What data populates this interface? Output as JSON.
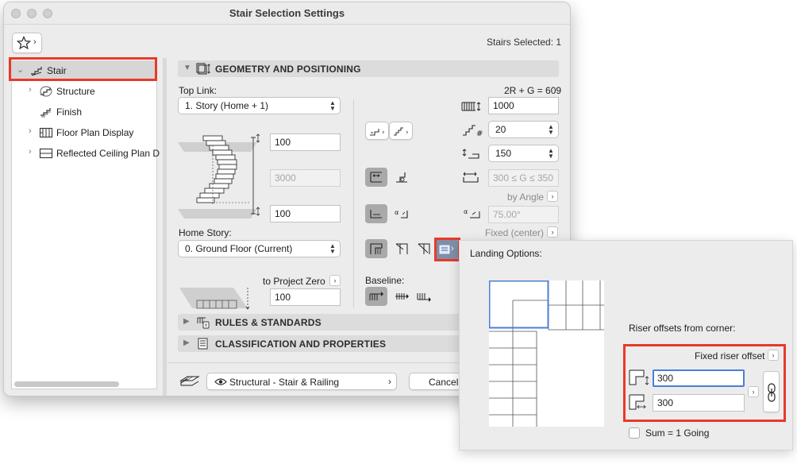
{
  "window": {
    "title": "Stair Selection Settings",
    "stairs_selected": "Stairs Selected: 1"
  },
  "sidebar": {
    "items": [
      {
        "label": "Stair",
        "icon": "stair-icon",
        "selected": true
      },
      {
        "label": "Structure",
        "icon": "structure-icon"
      },
      {
        "label": "Finish",
        "icon": "finish-icon"
      },
      {
        "label": "Floor Plan Display",
        "icon": "floor-plan-icon"
      },
      {
        "label": "Reflected Ceiling Plan D",
        "icon": "ceiling-plan-icon"
      }
    ]
  },
  "geometry": {
    "section_title": "GEOMETRY AND POSITIONING",
    "top_link_label": "Top Link:",
    "top_link_value": "1. Story (Home + 1)",
    "formula": "2R + G = 609",
    "top_offset": "100",
    "height": "3000",
    "bottom_offset": "100",
    "home_story_label": "Home Story:",
    "home_story_value": "0. Ground Floor (Current)",
    "to_project_zero": "to Project Zero",
    "project_zero_value": "100",
    "baseline_label": "Baseline:",
    "width_value": "1000",
    "riser_count": "20",
    "tread_depth": "150",
    "going_range": "300 ≤ G ≤ 350",
    "by_angle": "by Angle",
    "angle_value": "75.00°",
    "fixed_center": "Fixed (center)"
  },
  "sections": {
    "rules": "RULES & STANDARDS",
    "classification": "CLASSIFICATION AND PROPERTIES"
  },
  "footer": {
    "layer": "Structural - Stair & Railing",
    "cancel": "Cancel"
  },
  "landing_popover": {
    "title": "Landing Options:",
    "riser_offsets_label": "Riser offsets from corner:",
    "fixed_riser_offset": "Fixed riser offset",
    "offset_1": "300",
    "offset_2": "300",
    "sum_label": "Sum = 1 Going",
    "sum_checked": false
  },
  "colors": {
    "highlight_red": "#e8392b",
    "focus_blue": "#4a7fd4",
    "selected_gray": "#a9a9a9"
  }
}
